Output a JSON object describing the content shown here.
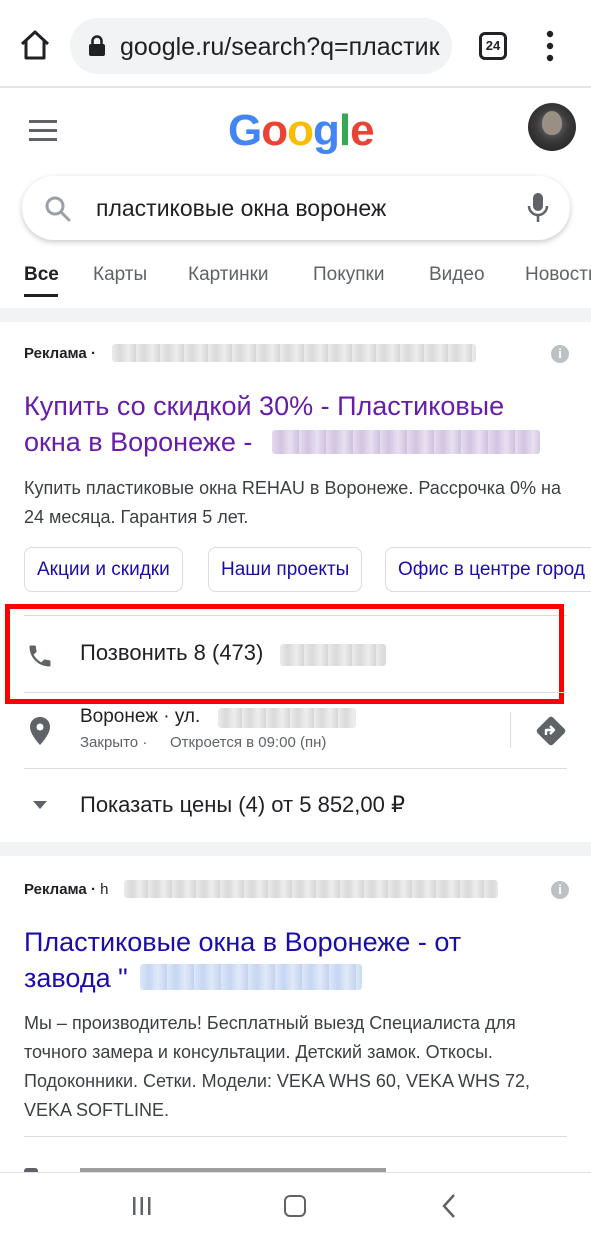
{
  "browser": {
    "url": "google.ru/search?q=пластик",
    "tab_count": "24"
  },
  "google": {
    "logo_text": [
      "G",
      "o",
      "o",
      "g",
      "l",
      "e"
    ],
    "logo_colors": [
      "#4285F4",
      "#EA4335",
      "#FBBC05",
      "#4285F4",
      "#34A853",
      "#EA4335"
    ],
    "search_query": "пластиковые окна воронеж",
    "tabs": [
      "Все",
      "Карты",
      "Картинки",
      "Покупки",
      "Видео",
      "Новости"
    ]
  },
  "ad1": {
    "label": "Реклама",
    "dot": "·",
    "title_line1": "Купить со скидкой 30% - Пластиковые",
    "title_line2": "окна в Воронеже -",
    "description": "Купить пластиковые окна REHAU в Воронеже. Рассрочка 0% на 24 месяца. Гарантия 5 лет.",
    "sitelinks": [
      "Акции и скидки",
      "Наши проекты",
      "Офис в центре город"
    ],
    "call_text": "Позвонить 8 (473)",
    "address": "Воронеж · ул.",
    "hours_closed": "Закрыто",
    "hours_dot": "·",
    "hours_open": "Откроется в 09:00 (пн)",
    "prices": "Показать цены (4) от 5 852,00 ₽"
  },
  "ad2": {
    "label": "Реклама",
    "dot": "·",
    "domain_start": "h",
    "title_line1": "Пластиковые окна в Воронеже - от",
    "title_line2": "завода \"",
    "description": "Мы – производитель! Бесплатный выезд Специалиста для точного замера и консультации. Детский замок. Откосы. Подоконники. Сетки. Модели: VEKA WHS 60, VEKA WHS 72, VEKA SOFTLINE."
  },
  "colors": {
    "visited_link": "#681da8",
    "link": "#1a0dab",
    "highlight": "#ff0000"
  }
}
